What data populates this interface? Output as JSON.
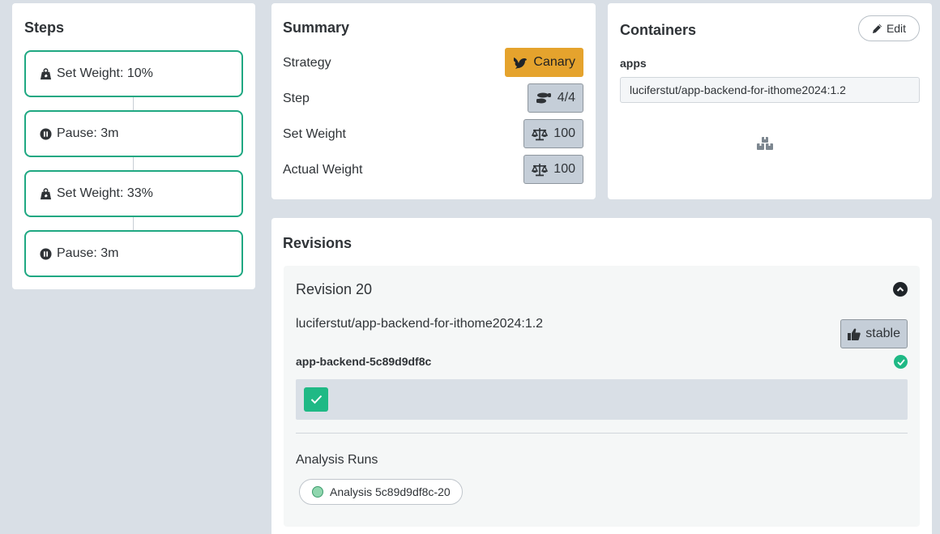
{
  "steps": {
    "title": "Steps",
    "items": [
      {
        "label": "Set Weight: 10%",
        "icon": "weight-icon"
      },
      {
        "label": "Pause: 3m",
        "icon": "pause-icon"
      },
      {
        "label": "Set Weight: 33%",
        "icon": "weight-icon"
      },
      {
        "label": "Pause: 3m",
        "icon": "pause-icon"
      }
    ]
  },
  "summary": {
    "title": "Summary",
    "rows": [
      {
        "label": "Strategy",
        "value": "Canary",
        "icon": "canary-bird-icon"
      },
      {
        "label": "Step",
        "value": "4/4",
        "icon": "shoe-prints-icon"
      },
      {
        "label": "Set Weight",
        "value": "100",
        "icon": "balance-scale-icon"
      },
      {
        "label": "Actual Weight",
        "value": "100",
        "icon": "balance-scale-icon"
      }
    ]
  },
  "containers": {
    "title": "Containers",
    "edit_label": "Edit",
    "name": "apps",
    "image": "luciferstut/app-backend-for-ithome2024:1.2"
  },
  "revisions": {
    "title": "Revisions",
    "revision_title": "Revision 20",
    "image": "luciferstut/app-backend-for-ithome2024:1.2",
    "badge": "stable",
    "replicaset": "app-backend-5c89d9df8c",
    "analysis_title": "Analysis Runs",
    "analysis_run": "Analysis 5c89d9df8c-20"
  },
  "colors": {
    "accent": "#1fa882",
    "canary": "#e5a32d",
    "success": "#1fb985",
    "background": "#d9dfe6"
  }
}
